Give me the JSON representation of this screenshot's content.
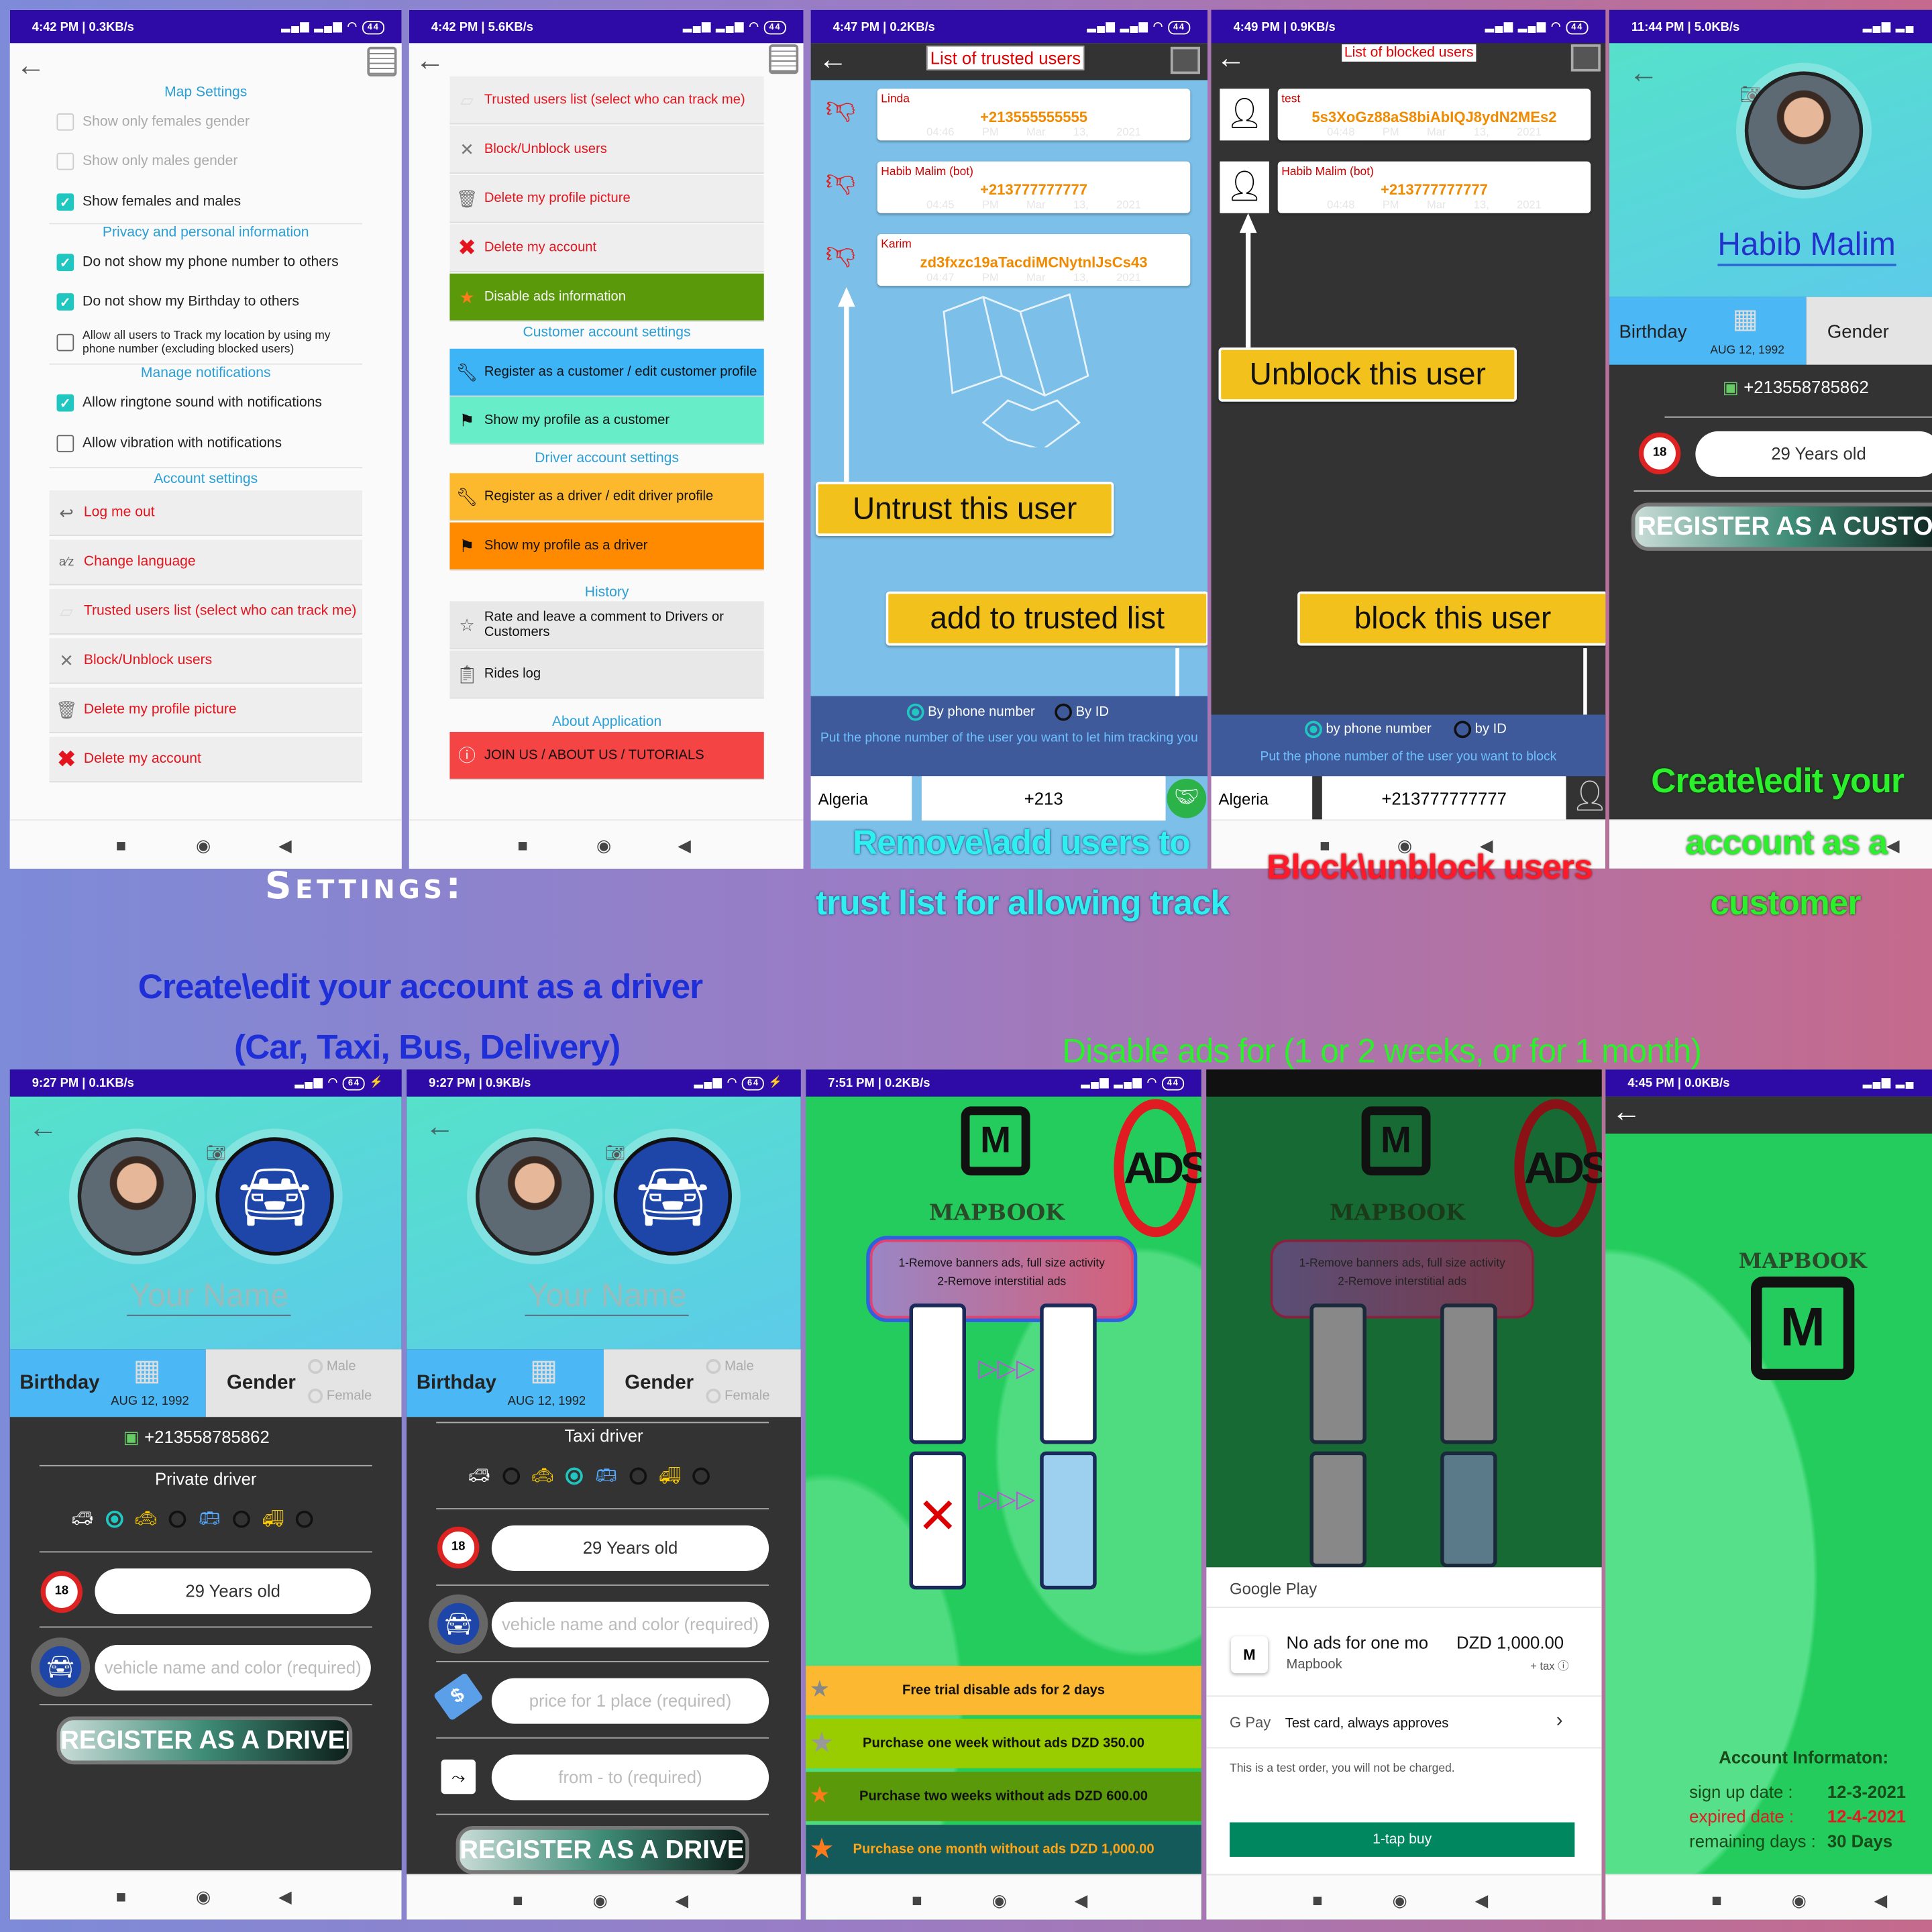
{
  "colors": {
    "status_bar": "#2e0ba6",
    "settings_header": "#2a9fd6",
    "danger_text": "#e4141e",
    "ads_green": "#5a9a0a",
    "customer_blue": "#3db4f5",
    "customer_teal": "#67edc8",
    "driver_yellow": "#fdb92e",
    "driver_orange": "#ff8a00",
    "about_red": "#f44444",
    "callout_yellow": "#f2c11c",
    "gpay_green": "#01875f"
  },
  "overlay": {
    "settings_title": "Settings:",
    "driver_caption_1": "Create\\edit your account as a driver",
    "driver_caption_2": "(Car, Taxi, Bus, Delivery)",
    "ads_caption": "Disable ads for (1 or 2 weeks, or for 1 month)",
    "trust_caption_1": "Remove\\add users to",
    "trust_caption_2": "trust list for allowing track",
    "block_caption": "Block\\unblock users",
    "customer_caption_1": "Create\\edit your",
    "customer_caption_2": "account as a",
    "customer_caption_3": "customer"
  },
  "screen1": {
    "status": "4:42 PM | 0.3KB/s",
    "battery": "44",
    "headers": [
      "Map Settings",
      "Privacy and personal information",
      "Manage notifications",
      "Account settings"
    ],
    "checkboxes": [
      {
        "label": "Show only females gender",
        "checked": false,
        "disabled": true
      },
      {
        "label": "Show only males gender",
        "checked": false,
        "disabled": true
      },
      {
        "label": "Show females and males",
        "checked": true
      },
      {
        "label": "Do not show my phone number to others",
        "checked": true
      },
      {
        "label": "Do not show my Birthday to others",
        "checked": true
      },
      {
        "label": "Allow all users to Track my location by using my phone number (excluding blocked users)",
        "checked": false
      },
      {
        "label": "Allow ringtone sound with notifications",
        "checked": true
      },
      {
        "label": "Allow vibration with notifications",
        "checked": false
      }
    ],
    "account_items": [
      {
        "label": "Log me out",
        "icon": "logout-icon"
      },
      {
        "label": "Change language",
        "icon": "language-icon"
      },
      {
        "label": "Trusted users list (select who can track me)",
        "icon": "map-icon"
      },
      {
        "label": "Block/Unblock users",
        "icon": "block-icon"
      },
      {
        "label": "Delete my profile picture",
        "icon": "trash-icon"
      },
      {
        "label": "Delete my account",
        "icon": "delete-icon"
      }
    ]
  },
  "screen2": {
    "status": "4:42 PM | 5.6KB/s",
    "battery": "44",
    "items": [
      "Trusted users list (select who can track me)",
      "Block/Unblock users",
      "Delete my profile picture",
      "Delete my account",
      "Disable ads information"
    ],
    "customer_header": "Customer account settings",
    "customer_items": [
      "Register as a customer / edit customer profile",
      "Show my profile as a customer"
    ],
    "driver_header": "Driver account settings",
    "driver_items": [
      "Register as a driver / edit driver profile",
      "Show my profile as a driver"
    ],
    "history_header": "History",
    "history_items": [
      "Rate and leave a comment to Drivers or Customers",
      "Rides log"
    ],
    "about_header": "About Application",
    "about_item": "JOIN US / ABOUT US / TUTORIALS"
  },
  "screen3": {
    "status": "4:47 PM | 0.2KB/s",
    "battery": "44",
    "title": "List of trusted users",
    "users": [
      {
        "name": "Linda",
        "value": "+213555555555",
        "time": "04:46 PM",
        "date": "Mar 13, 2021"
      },
      {
        "name": "Habib Malim (bot)",
        "value": "+213777777777",
        "time": "04:45 PM",
        "date": "Mar 13, 2021"
      },
      {
        "name": "Karim",
        "value": "zd3fxzc19aTacdiMCNytnlJsCs43",
        "time": "04:47 PM",
        "date": "Mar 13, 2021"
      }
    ],
    "callout_untrust": "Untrust this user",
    "callout_add": "add to trusted list",
    "radio_phone": "By phone number",
    "radio_id": "By ID",
    "selected": "By phone number",
    "hint": "Put the phone number of the user you want to let him tracking you",
    "country": "Algeria",
    "phone_value": "+213"
  },
  "screen4": {
    "status": "4:49 PM | 0.9KB/s",
    "battery": "44",
    "title": "List of blocked users",
    "users": [
      {
        "name": "test",
        "value": "5s3XoGz88aS8biAbIQJ8ydN2MEs2",
        "time": "04:48 PM",
        "date": "Mar 13, 2021"
      },
      {
        "name": "Habib Malim (bot)",
        "value": "+213777777777",
        "time": "04:48 PM",
        "date": "Mar 13, 2021"
      }
    ],
    "callout_unblock": "Unblock this user",
    "callout_block": "block this user",
    "radio_phone": "by phone number",
    "radio_id": "by ID",
    "selected": "by phone number",
    "hint": "Put the phone number of the user you want to block",
    "country": "Algeria",
    "phone_value": "+213777777777"
  },
  "screen5": {
    "status": "11:44 PM | 5.0KB/s",
    "name": "Habib Malim",
    "birthday_label": "Birthday",
    "birthday": "AUG 12, 1992",
    "gender_label": "Gender",
    "phone": "+213558785862",
    "age": "29 Years old",
    "register": "REGISTER AS A CUSTOM"
  },
  "screen6": {
    "status": "9:27 PM | 0.1KB/s",
    "battery": "64",
    "name_placeholder": "Your Name",
    "birthday_label": "Birthday",
    "birthday": "AUG 12, 1992",
    "gender_label": "Gender",
    "male": "Male",
    "female": "Female",
    "phone": "+213558785862",
    "driver_type": "Private driver",
    "selected_vehicle": "car",
    "age": "29 Years old",
    "vehicle_placeholder": "vehicle name and color (required)",
    "register": "REGISTER AS A DRIVER"
  },
  "screen7": {
    "status": "9:27 PM | 0.9KB/s",
    "battery": "64",
    "name_placeholder": "Your Name",
    "birthday_label": "Birthday",
    "birthday": "AUG 12, 1992",
    "gender_label": "Gender",
    "male": "Male",
    "female": "Female",
    "driver_type": "Taxi driver",
    "selected_vehicle": "taxi",
    "age": "29 Years old",
    "vehicle_placeholder": "vehicle name and color (required)",
    "price_placeholder": "price for 1 place (required)",
    "route_placeholder": "from - to (required)",
    "register": "REGISTER AS A DRIVER"
  },
  "screen8": {
    "status": "7:51 PM | 0.2KB/s",
    "battery": "44",
    "brand": "MAPBOOK",
    "ads_sign": "ADS",
    "feature_1": "1-Remove banners ads, full size activity",
    "feature_2": "2-Remove interstitial ads",
    "options": [
      "Free trial disable ads for 2 days",
      "Purchase one week without ads DZD 350.00",
      "Purchase two weeks without ads DZD 600.00",
      "Purchase one month without ads DZD 1,000.00"
    ]
  },
  "screen9": {
    "brand": "MAPBOOK",
    "ads_sign": "ADS",
    "feature_1": "1-Remove banners ads, full size activity",
    "feature_2": "2-Remove interstitial ads",
    "store": "Google Play",
    "product": "No ads for one mo",
    "price": "DZD 1,000.00",
    "app": "Mapbook",
    "tax": "+ tax ⓘ",
    "pay_brand": "G Pay",
    "payment": "Test card, always approves",
    "note": "This is a test order, you will not be charged.",
    "buy": "1-tap buy"
  },
  "screen10": {
    "status": "4:45 PM | 0.0KB/s",
    "brand": "MAPBOOK",
    "info_title": "Account Informaton:",
    "signup_label": "sign up date :",
    "signup": "12-3-2021",
    "expired_label": "expired date :",
    "expired": "12-4-2021",
    "remaining_label": "remaining days :",
    "remaining": "30 Days"
  }
}
